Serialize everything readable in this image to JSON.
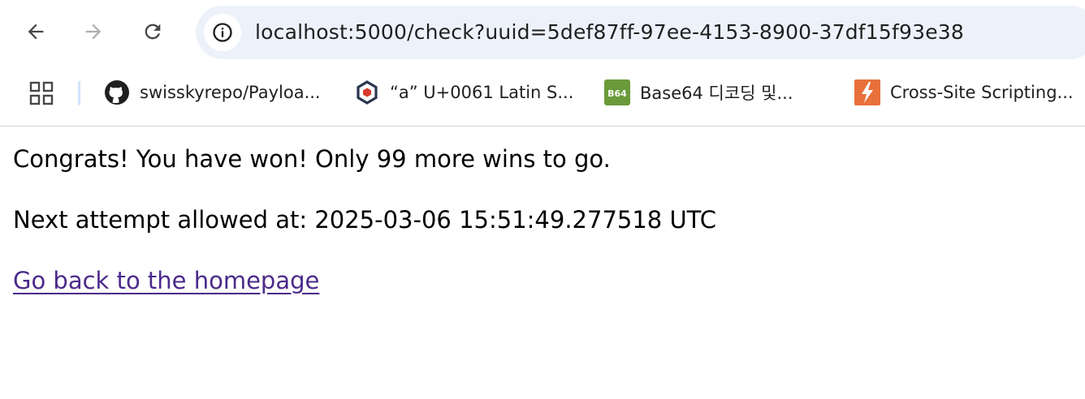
{
  "browser": {
    "url": "localhost:5000/check?uuid=5def87ff-97ee-4153-8900-37df15f93e38",
    "bookmarks": [
      {
        "label": "swisskyrepo/Payloa...",
        "icon": "github-icon"
      },
      {
        "label": "“a” U+0061 Latin S...",
        "icon": "hexagon-icon"
      },
      {
        "label": "Base64 디코딩 및...",
        "icon": "base64-icon",
        "icon_text": "B64"
      },
      {
        "label": "Cross-Site Scripting...",
        "icon": "lightning-icon"
      }
    ]
  },
  "page": {
    "message": "Congrats! You have won! Only 99 more wins to go.",
    "next_attempt": "Next attempt allowed at: 2025-03-06 15:51:49.277518 UTC",
    "back_link": "Go back to the homepage"
  },
  "colors": {
    "omnibox_bg": "#edf2fa",
    "visited_link": "#4b2a8a",
    "base64_icon": "#6a9a3a",
    "portswigger_icon": "#e8703a"
  }
}
